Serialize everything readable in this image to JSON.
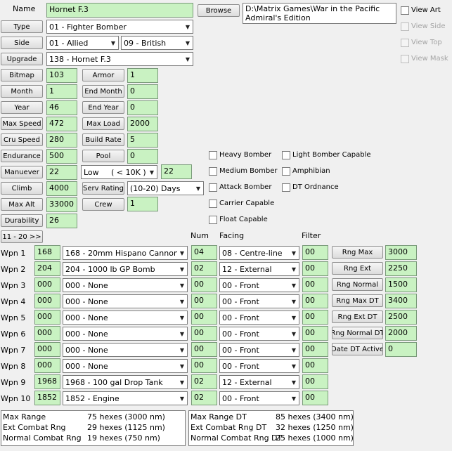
{
  "name": {
    "label": "Name",
    "value": "Hornet F.3"
  },
  "browse": {
    "label": "Browse",
    "path": "D:\\Matrix Games\\War in the Pacific Admiral's Edition"
  },
  "view": [
    {
      "label": "View Art",
      "enabled": true
    },
    {
      "label": "View Side",
      "enabled": false
    },
    {
      "label": "View Top",
      "enabled": false
    },
    {
      "label": "View Mask",
      "enabled": false
    }
  ],
  "type": {
    "label": "Type",
    "value": "01 - Fighter Bomber"
  },
  "side": {
    "label": "Side",
    "value": "01 - Allied",
    "nation": "09 - British"
  },
  "upgrade": {
    "label": "Upgrade",
    "value": "138 - Hornet F.3"
  },
  "left_fields": [
    {
      "label": "Bitmap",
      "value": "103"
    },
    {
      "label": "Month",
      "value": "1"
    },
    {
      "label": "Year",
      "value": "46"
    },
    {
      "label": "Max Speed",
      "value": "472"
    },
    {
      "label": "Cru Speed",
      "value": "280"
    },
    {
      "label": "Endurance",
      "value": "500"
    },
    {
      "label": "Manuever",
      "value": "22"
    },
    {
      "label": "Climb",
      "value": "4000"
    },
    {
      "label": "Max Alt",
      "value": "33000"
    },
    {
      "label": "Durability",
      "value": "26"
    }
  ],
  "right_fields": [
    {
      "label": "Armor",
      "value": "1"
    },
    {
      "label": "End Month",
      "value": "0"
    },
    {
      "label": "End Year",
      "value": "0"
    },
    {
      "label": "Max Load",
      "value": "2000"
    },
    {
      "label": "Build Rate",
      "value": "5"
    },
    {
      "label": "Pool",
      "value": "0"
    }
  ],
  "manuever_band": {
    "value": "Low     ( < 10K )",
    "extra": "22"
  },
  "serv_rating": {
    "label": "Serv Rating",
    "value": "(10-20) Days"
  },
  "crew": {
    "label": "Crew",
    "value": "1"
  },
  "checkboxes_col1": [
    "Heavy Bomber",
    "Medium Bomber",
    "Attack Bomber",
    "Carrier Capable",
    "Float Capable"
  ],
  "checkboxes_col2": [
    "Light Bomber Capable",
    "Amphibian",
    "DT Ordnance"
  ],
  "page_button": "11 - 20 >>",
  "headers": {
    "num": "Num",
    "facing": "Facing",
    "filter": "Filter"
  },
  "weapons": [
    {
      "label": "Wpn 1",
      "code": "168",
      "device": "168 - 20mm Hispano Cannon",
      "num": "04",
      "facing": "08 - Centre-line",
      "filter": "00"
    },
    {
      "label": "Wpn 2",
      "code": "204",
      "device": "204 - 1000 lb GP Bomb",
      "num": "02",
      "facing": "12 - External",
      "filter": "00"
    },
    {
      "label": "Wpn 3",
      "code": "000",
      "device": "000 - None",
      "num": "00",
      "facing": "00 - Front",
      "filter": "00"
    },
    {
      "label": "Wpn 4",
      "code": "000",
      "device": "000 - None",
      "num": "00",
      "facing": "00 - Front",
      "filter": "00"
    },
    {
      "label": "Wpn 5",
      "code": "000",
      "device": "000 - None",
      "num": "00",
      "facing": "00 - Front",
      "filter": "00"
    },
    {
      "label": "Wpn 6",
      "code": "000",
      "device": "000 - None",
      "num": "00",
      "facing": "00 - Front",
      "filter": "00"
    },
    {
      "label": "Wpn 7",
      "code": "000",
      "device": "000 - None",
      "num": "00",
      "facing": "00 - Front",
      "filter": "00"
    },
    {
      "label": "Wpn 8",
      "code": "000",
      "device": "000 - None",
      "num": "00",
      "facing": "00 - Front",
      "filter": "00"
    },
    {
      "label": "Wpn 9",
      "code": "1968",
      "device": "1968 - 100 gal Drop Tank",
      "num": "02",
      "facing": "12 - External",
      "filter": "00"
    },
    {
      "label": "Wpn 10",
      "code": "1852",
      "device": "1852 - Engine",
      "num": "02",
      "facing": "00 - Front",
      "filter": "00"
    }
  ],
  "range_fields": [
    {
      "label": "Rng Max",
      "value": "3000"
    },
    {
      "label": "Rng Ext",
      "value": "2250"
    },
    {
      "label": "Rng Normal",
      "value": "1500"
    },
    {
      "label": "Rng Max DT",
      "value": "3400"
    },
    {
      "label": "Rng Ext DT",
      "value": "2500"
    },
    {
      "label": "Rng Normal DT",
      "value": "2000"
    },
    {
      "label": "Date DT Active",
      "value": "0"
    }
  ],
  "summary_left": [
    {
      "label": "Max Range",
      "value": "75 hexes (3000 nm)"
    },
    {
      "label": "Ext Combat Rng",
      "value": "29 hexes (1125 nm)"
    },
    {
      "label": "Normal Combat Rng",
      "value": "19 hexes (750 nm)"
    }
  ],
  "summary_right": [
    {
      "label": "Max Range DT",
      "value": "85 hexes (3400 nm)"
    },
    {
      "label": "Ext Combat Rng DT",
      "value": "32 hexes (1250 nm)"
    },
    {
      "label": "Normal Combat Rng DT",
      "value": "25 hexes (1000 nm)"
    }
  ],
  "colors": {
    "field_green": "#c9f2c2",
    "background": "#f0f0f0"
  }
}
